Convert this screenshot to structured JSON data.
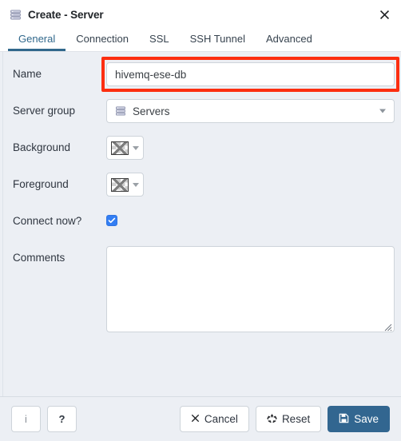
{
  "window": {
    "title": "Create - Server",
    "title_icon": "server-stack-icon",
    "close_icon": "✖"
  },
  "tabs": [
    {
      "label": "General",
      "active": true
    },
    {
      "label": "Connection",
      "active": false
    },
    {
      "label": "SSL",
      "active": false
    },
    {
      "label": "SSH Tunnel",
      "active": false
    },
    {
      "label": "Advanced",
      "active": false
    }
  ],
  "form": {
    "name": {
      "label": "Name",
      "value": "hivemq-ese-db",
      "placeholder": "",
      "highlighted": true,
      "highlight_color": "#fc2e10"
    },
    "server_group": {
      "label": "Server group",
      "value": "Servers",
      "icon": "server-stack-icon",
      "caret": "chevron-down-icon"
    },
    "background": {
      "label": "Background",
      "value": "",
      "swatch": "no-color-swatch"
    },
    "foreground": {
      "label": "Foreground",
      "value": "",
      "swatch": "no-color-swatch"
    },
    "connect_now": {
      "label": "Connect now?",
      "checked": true,
      "check_glyph": "✓",
      "accent": "#337ef3"
    },
    "comments": {
      "label": "Comments",
      "value": "",
      "placeholder": ""
    }
  },
  "footer": {
    "info": {
      "label": "i",
      "name": "info-button"
    },
    "help": {
      "label": "?",
      "name": "help-button"
    },
    "cancel": {
      "label": "Cancel",
      "icon": "✖"
    },
    "reset": {
      "label": "Reset",
      "icon": "♻"
    },
    "save": {
      "label": "Save",
      "icon": "floppy-disk-icon",
      "color": "#326690"
    }
  }
}
